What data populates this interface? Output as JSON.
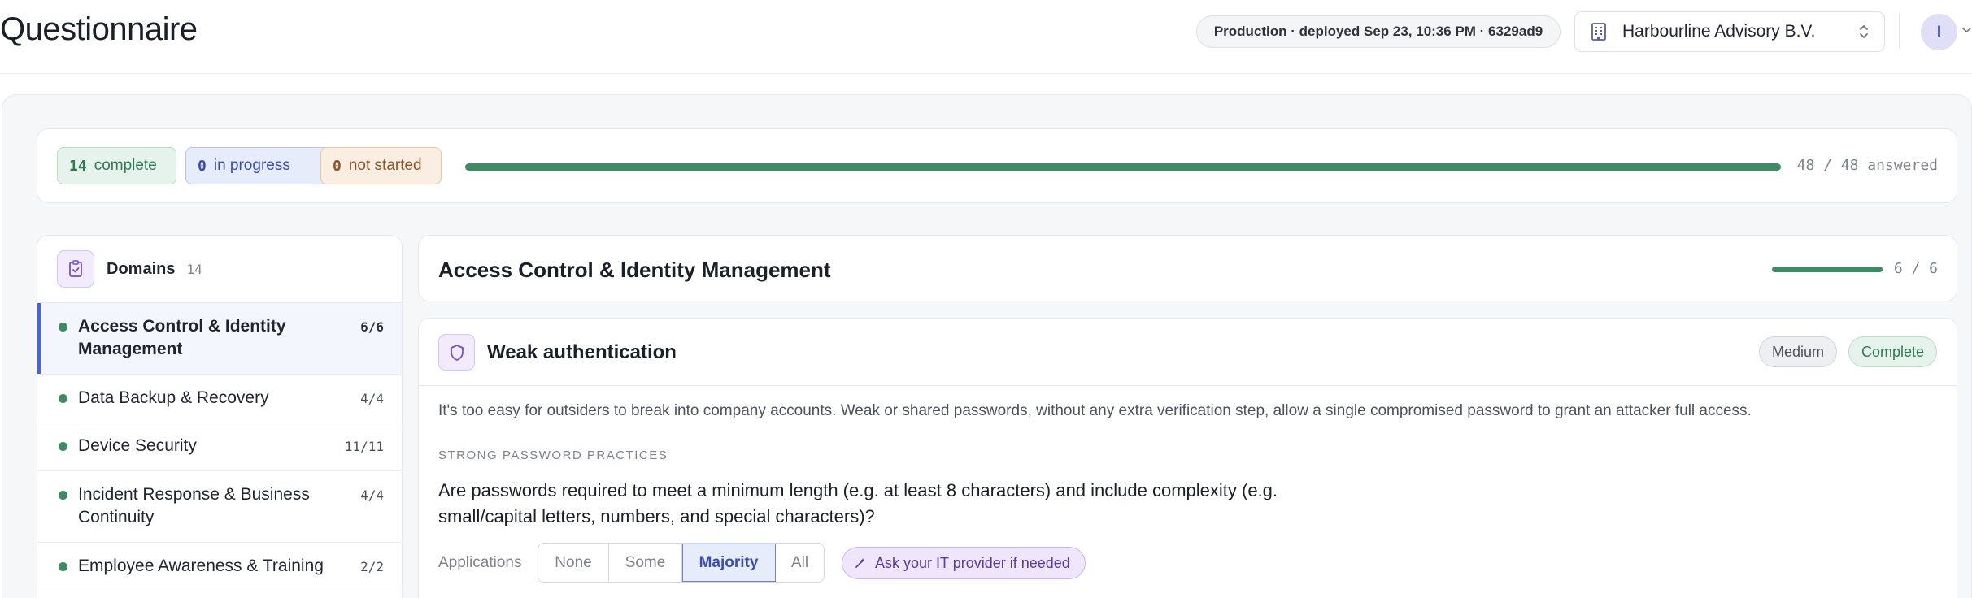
{
  "header": {
    "title": "Questionnaire",
    "deploy_info": "Production · deployed Sep 23, 10:36 PM · 6329ad9",
    "org_name": "Harbourline Advisory B.V.",
    "avatar_initial": "I"
  },
  "summary": {
    "complete_count": "14",
    "complete_label": "complete",
    "in_progress_count": "0",
    "in_progress_label": "in progress",
    "not_started_count": "0",
    "not_started_label": "not started",
    "progress_fraction": 1.0,
    "answered_text": "48 / 48 answered"
  },
  "sidebar": {
    "title": "Domains",
    "count": "14",
    "items": [
      {
        "label": "Access Control & Identity Management",
        "count": "6/6",
        "active": true,
        "lines": 2
      },
      {
        "label": "Data Backup & Recovery",
        "count": "4/4",
        "active": false,
        "lines": 1
      },
      {
        "label": "Device Security",
        "count": "11/11",
        "active": false,
        "lines": 1
      },
      {
        "label": "Incident Response & Business Continuity",
        "count": "4/4",
        "active": false,
        "lines": 2
      },
      {
        "label": "Employee Awareness & Training",
        "count": "2/2",
        "active": false,
        "lines": 1
      }
    ]
  },
  "domain": {
    "title": "Access Control & Identity Management",
    "progress_fraction": 1.0,
    "count_text": "6 / 6"
  },
  "risk": {
    "title": "Weak authentication",
    "severity": "Medium",
    "status": "Complete",
    "description": "It's too easy for outsiders to break into company accounts. Weak or shared passwords, without any extra verification step, allow a single compromised password to grant an attacker full access.",
    "section_label": "STRONG PASSWORD PRACTICES",
    "question": "Are passwords required to meet a minimum length (e.g. at least 8 characters) and include complexity (e.g. small/capital letters, numbers, and special characters)?",
    "scope_label": "Applications",
    "options": [
      "None",
      "Some",
      "Majority",
      "All"
    ],
    "selected_option": "Majority",
    "ask_label": "Ask your IT provider if needed"
  },
  "colors": {
    "accent_green": "#3e8a63",
    "accent_blue": "#4b63d8",
    "accent_purple": "#5a3a9a"
  },
  "icons": {
    "org": "building-icon",
    "org_select": "chevron-updown-icon",
    "sidebar": "clipboard-check-icon",
    "risk": "shield-icon",
    "ask": "wand-icon"
  }
}
